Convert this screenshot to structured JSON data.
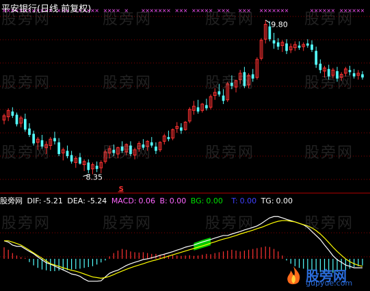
{
  "chart_title": "平安银行(日线 前复权)",
  "watermark_text": "股旁网",
  "indicator_bar": {
    "name": "股旁网",
    "dif_label": "DIF:",
    "dif_value": "-5.21",
    "dea_label": "DEA:",
    "dea_value": "-5.24",
    "macd_label": "MACD:",
    "macd_value": "0.06",
    "b_label": "B:",
    "b_value": "0.00",
    "bg_label": "BG:",
    "bg_value": "0.00",
    "t_label": "T:",
    "t_value": "0.00",
    "tg_label": "TG:",
    "tg_value": "0.00"
  },
  "logo": {
    "text": "股旁网",
    "url": "gupyue.com"
  },
  "colors": {
    "background": "#000000",
    "up": "#ff3232",
    "down": "#54ffff",
    "grid": "#8b0000",
    "separator": "#b40000",
    "x_marker": "#ff55ff",
    "dif_line": "#ffffff",
    "dea_line": "#ffff00",
    "bg_fill": "#00e000",
    "t_text": "#4040ff"
  },
  "chart_data": [
    {
      "type": "candlestick",
      "title": "平安银行(日线 前复权)",
      "annotations": [
        {
          "label": "9.80",
          "value": 9.8,
          "kind": "high"
        },
        {
          "label": "8.35",
          "value": 8.35,
          "kind": "low"
        },
        {
          "label": "S",
          "kind": "signal"
        }
      ],
      "ylim": [
        8.25,
        9.86
      ],
      "top_markers": "××× signal row",
      "candles": [
        [
          8.86,
          8.92,
          8.82,
          8.9
        ],
        [
          8.89,
          8.97,
          8.85,
          8.95
        ],
        [
          8.94,
          8.98,
          8.88,
          8.9
        ],
        [
          8.91,
          8.93,
          8.8,
          8.82
        ],
        [
          8.83,
          8.9,
          8.79,
          8.88
        ],
        [
          8.87,
          8.92,
          8.75,
          8.77
        ],
        [
          8.78,
          8.83,
          8.7,
          8.72
        ],
        [
          8.73,
          8.76,
          8.62,
          8.64
        ],
        [
          8.65,
          8.7,
          8.58,
          8.68
        ],
        [
          8.67,
          8.72,
          8.59,
          8.61
        ],
        [
          8.6,
          8.66,
          8.54,
          8.63
        ],
        [
          8.62,
          8.7,
          8.58,
          8.68
        ],
        [
          8.69,
          8.75,
          8.63,
          8.66
        ],
        [
          8.65,
          8.69,
          8.52,
          8.54
        ],
        [
          8.55,
          8.6,
          8.48,
          8.58
        ],
        [
          8.57,
          8.62,
          8.5,
          8.52
        ],
        [
          8.53,
          8.57,
          8.45,
          8.47
        ],
        [
          8.46,
          8.52,
          8.41,
          8.5
        ],
        [
          8.51,
          8.55,
          8.44,
          8.45
        ],
        [
          8.44,
          8.49,
          8.38,
          8.47
        ],
        [
          8.46,
          8.49,
          8.36,
          8.39
        ],
        [
          8.4,
          8.46,
          8.35,
          8.44
        ],
        [
          8.43,
          8.47,
          8.37,
          8.4
        ],
        [
          8.41,
          8.48,
          8.36,
          8.46
        ],
        [
          8.47,
          8.58,
          8.45,
          8.56
        ],
        [
          8.55,
          8.62,
          8.5,
          8.59
        ],
        [
          8.58,
          8.63,
          8.52,
          8.55
        ],
        [
          8.54,
          8.61,
          8.5,
          8.6
        ],
        [
          8.61,
          8.66,
          8.55,
          8.57
        ],
        [
          8.56,
          8.64,
          8.53,
          8.63
        ],
        [
          8.62,
          8.66,
          8.52,
          8.54
        ],
        [
          8.53,
          8.6,
          8.49,
          8.58
        ],
        [
          8.59,
          8.66,
          8.56,
          8.64
        ],
        [
          8.63,
          8.68,
          8.58,
          8.6
        ],
        [
          8.61,
          8.67,
          8.57,
          8.66
        ],
        [
          8.65,
          8.7,
          8.6,
          8.62
        ],
        [
          8.61,
          8.65,
          8.54,
          8.57
        ],
        [
          8.58,
          8.66,
          8.56,
          8.65
        ],
        [
          8.66,
          8.73,
          8.63,
          8.71
        ],
        [
          8.7,
          8.76,
          8.66,
          8.68
        ],
        [
          8.69,
          8.78,
          8.67,
          8.77
        ],
        [
          8.78,
          8.84,
          8.74,
          8.8
        ],
        [
          8.79,
          8.83,
          8.73,
          8.76
        ],
        [
          8.77,
          8.85,
          8.76,
          8.84
        ],
        [
          8.85,
          8.98,
          8.83,
          8.96
        ],
        [
          8.95,
          9.04,
          8.91,
          8.99
        ],
        [
          8.98,
          9.05,
          8.92,
          8.94
        ],
        [
          8.95,
          9.02,
          8.93,
          9.01
        ],
        [
          9.0,
          9.06,
          8.95,
          8.97
        ],
        [
          8.98,
          9.1,
          8.96,
          9.08
        ],
        [
          9.09,
          9.16,
          9.05,
          9.12
        ],
        [
          9.13,
          9.2,
          9.08,
          9.1
        ],
        [
          9.09,
          9.15,
          9.01,
          9.04
        ],
        [
          9.05,
          9.22,
          9.03,
          9.2
        ],
        [
          9.21,
          9.28,
          9.15,
          9.18
        ],
        [
          9.17,
          9.24,
          9.12,
          9.23
        ],
        [
          9.24,
          9.33,
          9.2,
          9.3
        ],
        [
          9.31,
          9.36,
          9.16,
          9.18
        ],
        [
          9.19,
          9.3,
          9.16,
          9.28
        ],
        [
          9.29,
          9.34,
          9.22,
          9.25
        ],
        [
          9.26,
          9.45,
          9.24,
          9.43
        ],
        [
          9.44,
          9.63,
          9.42,
          9.61
        ],
        [
          9.62,
          9.8,
          9.58,
          9.76
        ],
        [
          9.74,
          9.79,
          9.6,
          9.62
        ],
        [
          9.61,
          9.68,
          9.53,
          9.58
        ],
        [
          9.59,
          9.63,
          9.52,
          9.55
        ],
        [
          9.56,
          9.61,
          9.5,
          9.59
        ],
        [
          9.58,
          9.62,
          9.48,
          9.51
        ],
        [
          9.52,
          9.58,
          9.49,
          9.55
        ],
        [
          9.54,
          9.6,
          9.51,
          9.57
        ],
        [
          9.56,
          9.6,
          9.52,
          9.54
        ],
        [
          9.55,
          9.59,
          9.51,
          9.57
        ],
        [
          9.58,
          9.62,
          9.54,
          9.56
        ],
        [
          9.57,
          9.61,
          9.5,
          9.52
        ],
        [
          9.51,
          9.55,
          9.35,
          9.38
        ],
        [
          9.39,
          9.43,
          9.3,
          9.33
        ],
        [
          9.32,
          9.37,
          9.26,
          9.35
        ],
        [
          9.34,
          9.38,
          9.24,
          9.27
        ],
        [
          9.28,
          9.35,
          9.25,
          9.33
        ],
        [
          9.32,
          9.36,
          9.22,
          9.25
        ],
        [
          9.26,
          9.31,
          9.23,
          9.29
        ],
        [
          9.3,
          9.36,
          9.27,
          9.34
        ],
        [
          9.33,
          9.37,
          9.28,
          9.31
        ],
        [
          9.3,
          9.34,
          9.25,
          9.27
        ],
        [
          9.28,
          9.33,
          9.24,
          9.3
        ],
        [
          9.29,
          9.32,
          9.24,
          9.26
        ]
      ]
    },
    {
      "type": "line",
      "series": [
        {
          "name": "DIF",
          "values": [
            0.0,
            -0.06,
            -0.2,
            -0.26,
            -0.26,
            -0.38,
            -0.5,
            -0.61,
            -0.76,
            -0.9,
            -1.03,
            -1.1,
            -1.19,
            -1.28,
            -1.37,
            -1.46,
            -1.56,
            -1.6,
            -1.67,
            -1.8,
            -1.9,
            -1.9,
            -1.9,
            -1.88,
            -1.7,
            -1.53,
            -1.44,
            -1.38,
            -1.27,
            -1.16,
            -1.08,
            -1.01,
            -0.95,
            -0.88,
            -0.85,
            -0.8,
            -0.75,
            -0.68,
            -0.63,
            -0.57,
            -0.51,
            -0.44,
            -0.38,
            -0.3,
            -0.25,
            -0.2,
            -0.13,
            -0.06,
            0.0,
            0.06,
            0.13,
            0.19,
            0.25,
            0.25,
            0.32,
            0.38,
            0.44,
            0.51,
            0.57,
            0.63,
            0.7,
            0.81,
            0.95,
            1.08,
            1.14,
            1.14,
            1.08,
            1.01,
            0.95,
            0.89,
            0.82,
            0.75,
            0.63,
            0.44,
            0.25,
            0.06,
            -0.2,
            -0.44,
            -0.7,
            -0.89,
            -1.01,
            -1.14,
            -1.2,
            -1.27,
            -1.27,
            -1.27
          ]
        },
        {
          "name": "DEA",
          "values": [
            0.0,
            0.0,
            -0.06,
            -0.13,
            -0.2,
            -0.32,
            -0.44,
            -0.57,
            -0.7,
            -0.82,
            -0.95,
            -1.08,
            -1.14,
            -1.2,
            -1.27,
            -1.33,
            -1.39,
            -1.43,
            -1.49,
            -1.56,
            -1.63,
            -1.7,
            -1.73,
            -1.76,
            -1.73,
            -1.67,
            -1.59,
            -1.5,
            -1.42,
            -1.34,
            -1.27,
            -1.2,
            -1.14,
            -1.08,
            -1.01,
            -0.95,
            -0.9,
            -0.84,
            -0.78,
            -0.72,
            -0.66,
            -0.6,
            -0.54,
            -0.48,
            -0.42,
            -0.36,
            -0.3,
            -0.24,
            -0.18,
            -0.11,
            -0.05,
            0.02,
            0.08,
            0.13,
            0.19,
            0.25,
            0.32,
            0.38,
            0.44,
            0.5,
            0.57,
            0.63,
            0.71,
            0.79,
            0.86,
            0.92,
            0.95,
            0.95,
            0.92,
            0.89,
            0.82,
            0.76,
            0.7,
            0.61,
            0.48,
            0.32,
            0.13,
            -0.08,
            -0.3,
            -0.5,
            -0.68,
            -0.85,
            -0.98,
            -1.08,
            -1.15,
            -1.2
          ]
        }
      ]
    },
    {
      "type": "bar",
      "name": "MACD histogram",
      "values": [
        0.7,
        0.55,
        0.35,
        0.2,
        0.1,
        0.05,
        -0.2,
        -0.4,
        -0.55,
        -0.65,
        -0.7,
        -0.75,
        -0.75,
        -0.72,
        -0.7,
        -0.68,
        -0.65,
        -0.62,
        -0.6,
        -0.55,
        -0.5,
        -0.45,
        -0.35,
        -0.22,
        -0.1,
        0.15,
        0.35,
        0.5,
        0.6,
        0.55,
        0.45,
        0.4,
        0.38,
        0.4,
        0.35,
        0.3,
        0.3,
        0.25,
        0.25,
        0.2,
        0.22,
        0.2,
        0.18,
        0.2,
        0.22,
        0.18,
        0.2,
        0.25,
        0.3,
        0.28,
        0.35,
        0.4,
        0.45,
        0.5,
        0.55,
        0.5,
        0.45,
        0.5,
        0.55,
        0.6,
        0.65,
        0.7,
        0.75,
        0.72,
        0.6,
        0.45,
        0.2,
        -0.1,
        -0.3,
        -0.45,
        -0.55,
        -0.6,
        -0.65,
        -0.7,
        -0.75,
        -0.8,
        -0.85,
        -0.9,
        -0.85,
        -0.8,
        -0.75,
        -0.7,
        -0.6,
        -0.5,
        -0.45,
        -0.4
      ]
    }
  ]
}
